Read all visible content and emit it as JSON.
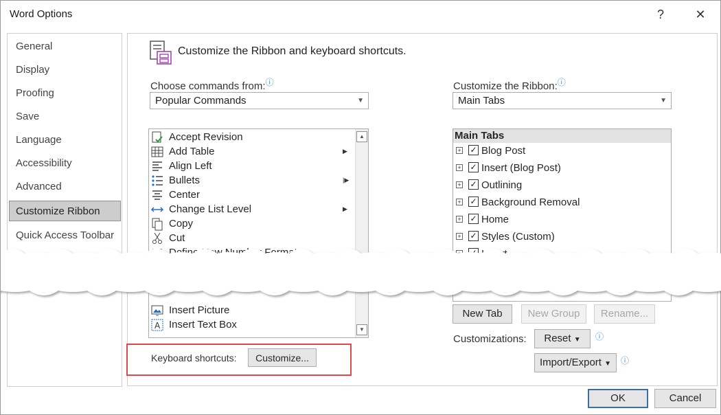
{
  "window": {
    "title": "Word Options",
    "help": "?",
    "close": "✕"
  },
  "nav": {
    "items": [
      "General",
      "Display",
      "Proofing",
      "Save",
      "Language",
      "Accessibility",
      "Advanced",
      "Customize Ribbon",
      "Quick Access Toolbar"
    ],
    "selected": "Customize Ribbon"
  },
  "header": {
    "text": "Customize the Ribbon and keyboard shortcuts."
  },
  "left": {
    "label": "Choose commands from:",
    "combo_value": "Popular Commands",
    "commands_top": [
      {
        "label": "Accept Revision",
        "icon": "accept-revision-icon"
      },
      {
        "label": "Add Table",
        "icon": "table-icon",
        "submenu": "▶"
      },
      {
        "label": "Align Left",
        "icon": "align-left-icon"
      },
      {
        "label": "Bullets",
        "icon": "bullets-icon",
        "submenu": "|▶"
      },
      {
        "label": "Center",
        "icon": "center-icon"
      },
      {
        "label": "Change List Level",
        "icon": "list-level-icon",
        "submenu": "▶"
      },
      {
        "label": "Copy",
        "icon": "copy-icon"
      },
      {
        "label": "Cut",
        "icon": "scissors-icon"
      },
      {
        "label": "Define New Number Format...",
        "icon": "number-format-icon"
      }
    ],
    "commands_bottom": [
      {
        "label": "Insert Picture",
        "icon": "picture-icon"
      },
      {
        "label": "Insert Text Box",
        "icon": "text-box-icon"
      }
    ]
  },
  "right": {
    "label": "Customize the Ribbon:",
    "combo_value": "Main Tabs",
    "tree_header": "Main Tabs",
    "tabs": [
      {
        "label": "Blog Post",
        "checked": true
      },
      {
        "label": "Insert (Blog Post)",
        "checked": true
      },
      {
        "label": "Outlining",
        "checked": true
      },
      {
        "label": "Background Removal",
        "checked": true
      },
      {
        "label": "Home",
        "checked": true
      },
      {
        "label": "Styles (Custom)",
        "checked": true
      },
      {
        "label": "Insert",
        "checked": true
      }
    ],
    "new_tab": "New Tab",
    "new_group": "New Group",
    "rename": "Rename...",
    "customizations_label": "Customizations:",
    "reset": "Reset",
    "import_export": "Import/Export"
  },
  "keyboard": {
    "label": "Keyboard shortcuts:",
    "button": "Customize..."
  },
  "footer": {
    "ok": "OK",
    "cancel": "Cancel"
  },
  "colors": {
    "accent": "#3a6ea5",
    "highlight": "#e0474c",
    "info": "#3b7fd1"
  }
}
